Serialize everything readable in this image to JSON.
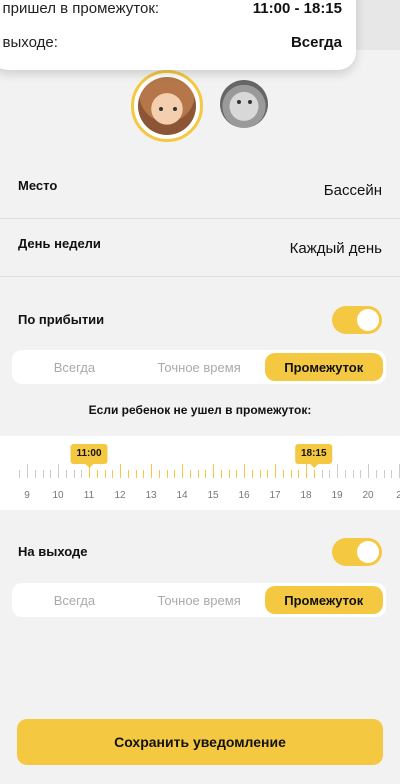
{
  "summary": {
    "arrived_label": "е пришел в промежуток:",
    "arrived_value": "11:00 - 18:15",
    "exit_label": "а выходе:",
    "exit_value": "Всегда"
  },
  "settings": {
    "place_label": "Место",
    "place_value": "Бассейн",
    "day_label": "День недели",
    "day_value": "Каждый день"
  },
  "arrival": {
    "label": "По прибытии",
    "toggle_on": true,
    "options": [
      "Всегда",
      "Точное время",
      "Промежуток"
    ],
    "selected": "Промежуток"
  },
  "range": {
    "caption": "Если ребенок не ушел в промежуток:",
    "start": "11:00",
    "end": "18:15",
    "hours": [
      "9",
      "10",
      "11",
      "12",
      "13",
      "14",
      "15",
      "16",
      "17",
      "18",
      "19",
      "20",
      "2"
    ]
  },
  "exit": {
    "label": "На выходе",
    "toggle_on": true,
    "options": [
      "Всегда",
      "Точное время",
      "Промежуток"
    ],
    "selected": "Промежуток"
  },
  "save_label": "Сохранить уведомление",
  "colors": {
    "accent": "#f5c842",
    "background": "#f2f2f2"
  }
}
